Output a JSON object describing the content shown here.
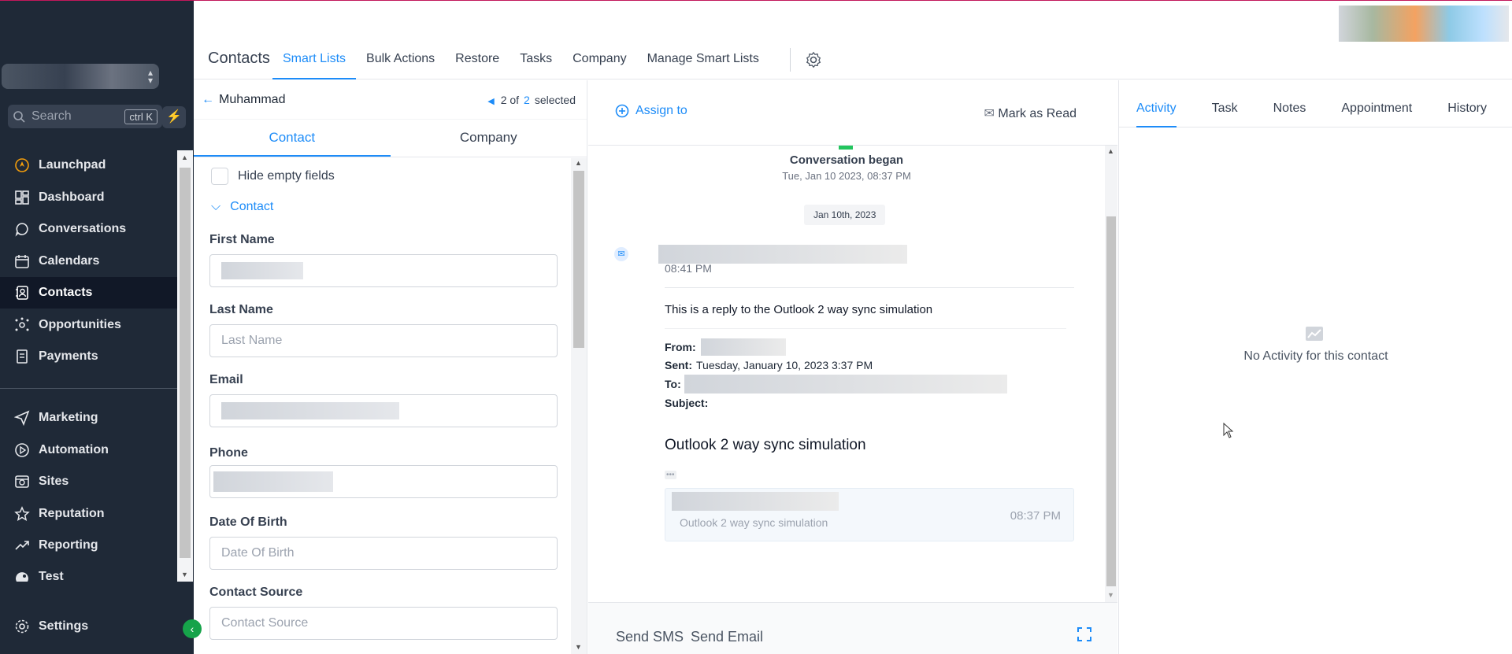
{
  "sidebar": {
    "search_placeholder": "Search",
    "search_shortcut": "ctrl K",
    "items": [
      {
        "label": "Launchpad",
        "icon": "launchpad-icon"
      },
      {
        "label": "Dashboard",
        "icon": "dashboard-icon"
      },
      {
        "label": "Conversations",
        "icon": "chat-icon"
      },
      {
        "label": "Calendars",
        "icon": "calendar-icon"
      },
      {
        "label": "Contacts",
        "icon": "contacts-icon",
        "active": true
      },
      {
        "label": "Opportunities",
        "icon": "opportunities-icon"
      },
      {
        "label": "Payments",
        "icon": "payments-icon"
      },
      {
        "label": "Marketing",
        "icon": "send-icon"
      },
      {
        "label": "Automation",
        "icon": "automation-icon"
      },
      {
        "label": "Sites",
        "icon": "globe-icon"
      },
      {
        "label": "Reputation",
        "icon": "star-icon"
      },
      {
        "label": "Reporting",
        "icon": "trend-icon"
      },
      {
        "label": "Test",
        "icon": "test-icon"
      },
      {
        "label": "Settings",
        "icon": "gear-icon"
      }
    ]
  },
  "header": {
    "title": "Contacts",
    "tabs": [
      "Smart Lists",
      "Bulk Actions",
      "Restore",
      "Tasks",
      "Company",
      "Manage Smart Lists"
    ],
    "active_tab": "Smart Lists"
  },
  "contact_panel": {
    "name": "Muhammad",
    "pager_current": "2 of",
    "pager_total": "2",
    "pager_suffix": "selected",
    "tabs": [
      "Contact",
      "Company"
    ],
    "hide_empty_label": "Hide empty fields",
    "section_label": "Contact",
    "fields": [
      {
        "label": "First Name",
        "placeholder": ""
      },
      {
        "label": "Last Name",
        "placeholder": "Last Name"
      },
      {
        "label": "Email",
        "placeholder": ""
      },
      {
        "label": "Phone",
        "placeholder": ""
      },
      {
        "label": "Date Of Birth",
        "placeholder": "Date Of Birth"
      },
      {
        "label": "Contact Source",
        "placeholder": "Contact Source"
      }
    ]
  },
  "conversation": {
    "assign_label": "Assign to",
    "mark_read_label": "Mark as Read",
    "began_title": "Conversation began",
    "began_time": "Tue, Jan 10 2023, 08:37 PM",
    "date_pill": "Jan 10th, 2023",
    "message_time": "08:41 PM",
    "body_line": "This is a reply to the Outlook 2 way sync simulation",
    "from_label": "From:",
    "sent_label": "Sent:",
    "sent_value": "Tuesday, January 10, 2023 3:37 PM",
    "to_label": "To:",
    "subject_label": "Subject:",
    "quoted_heading": "Outlook 2 way sync simulation",
    "ellipsis": "•••",
    "preview_text": "Outlook 2 way sync simulation",
    "preview_time": "08:37 PM",
    "footer_sms": "Send SMS",
    "footer_email": "Send Email"
  },
  "right_panel": {
    "tabs": [
      "Activity",
      "Task",
      "Notes",
      "Appointment",
      "History"
    ],
    "active_tab": "Activity",
    "empty_text": "No Activity for this contact"
  },
  "colors": {
    "accent": "#1d8cf8",
    "sidebar_bg": "#1f2937",
    "green": "#16a34a"
  }
}
